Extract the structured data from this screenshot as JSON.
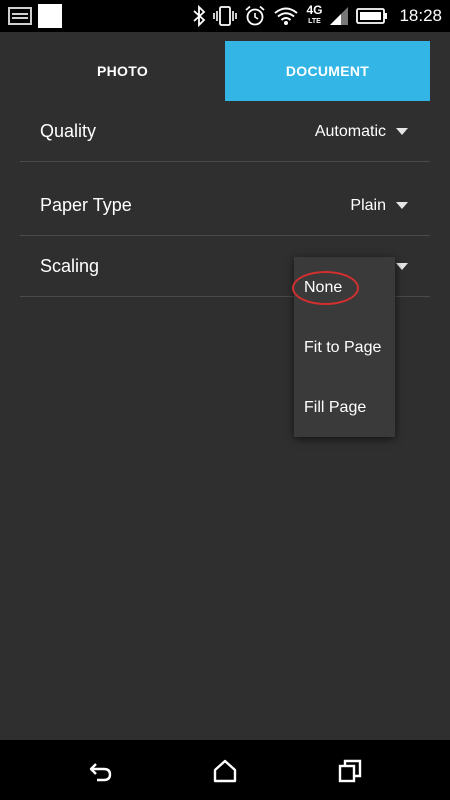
{
  "status_bar": {
    "time": "18:28",
    "network": "4G",
    "network_sub": "LTE",
    "icons": [
      "gallery-notification-icon",
      "white-square-notification-icon",
      "bluetooth-icon",
      "vibrate-icon",
      "alarm-icon",
      "wifi-icon",
      "signal-icon",
      "battery-icon"
    ]
  },
  "tabs": [
    {
      "label": "PHOTO",
      "active": false
    },
    {
      "label": "DOCUMENT",
      "active": true
    }
  ],
  "settings": [
    {
      "label": "Quality",
      "value": "Automatic"
    },
    {
      "label": "Paper Type",
      "value": "Plain"
    },
    {
      "label": "Scaling",
      "value": ""
    }
  ],
  "dropdown": {
    "options": [
      "None",
      "Fit to Page",
      "Fill Page"
    ],
    "highlighted": "None"
  },
  "colors": {
    "accent": "#33b5e5",
    "background": "#2f2f2f",
    "annotation": "#d32f2f"
  },
  "nav_bar": {
    "icons": [
      "back-icon",
      "home-icon",
      "recent-apps-icon"
    ]
  }
}
